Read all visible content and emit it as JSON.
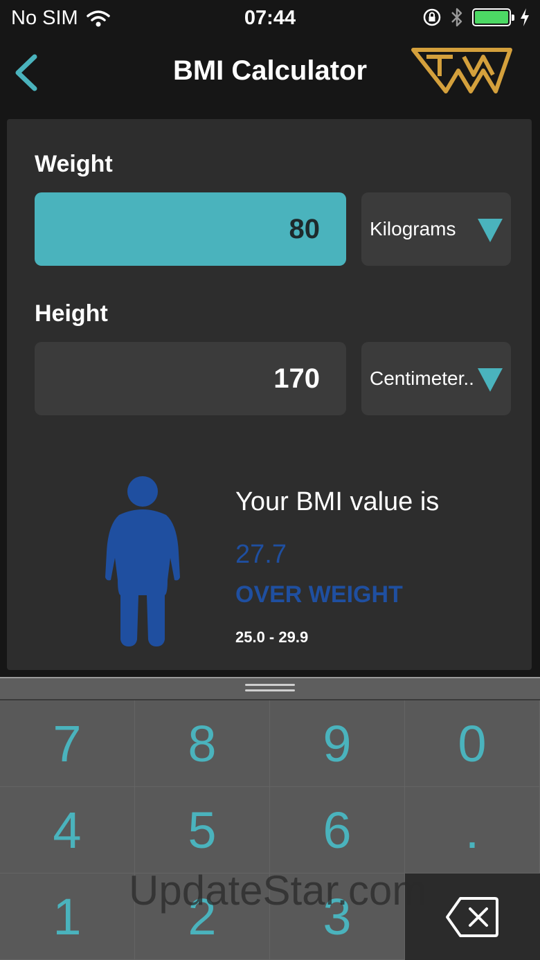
{
  "status_bar": {
    "carrier": "No SIM",
    "time": "07:44",
    "battery_color": "#4cd964"
  },
  "nav": {
    "title": "BMI Calculator",
    "back_icon": "chevron-left-icon",
    "logo_icon": "brand-logo-icon",
    "accent_color": "#4ab3bd",
    "logo_color": "#d4a03c"
  },
  "weight": {
    "label": "Weight",
    "value": "80",
    "unit": "Kilograms"
  },
  "height": {
    "label": "Height",
    "value": "170",
    "unit": "Centimeter.."
  },
  "result": {
    "heading": "Your BMI value is",
    "value": "27.7",
    "category": "OVER WEIGHT",
    "range": "25.0 - 29.9",
    "category_color": "#1f4fa0"
  },
  "keypad": {
    "keys": [
      "7",
      "8",
      "9",
      "0",
      "4",
      "5",
      "6",
      ".",
      "1",
      "2",
      "3"
    ],
    "backspace_icon": "backspace-icon",
    "key_color": "#4ab3bd"
  },
  "watermark": "UpdateStar.com"
}
